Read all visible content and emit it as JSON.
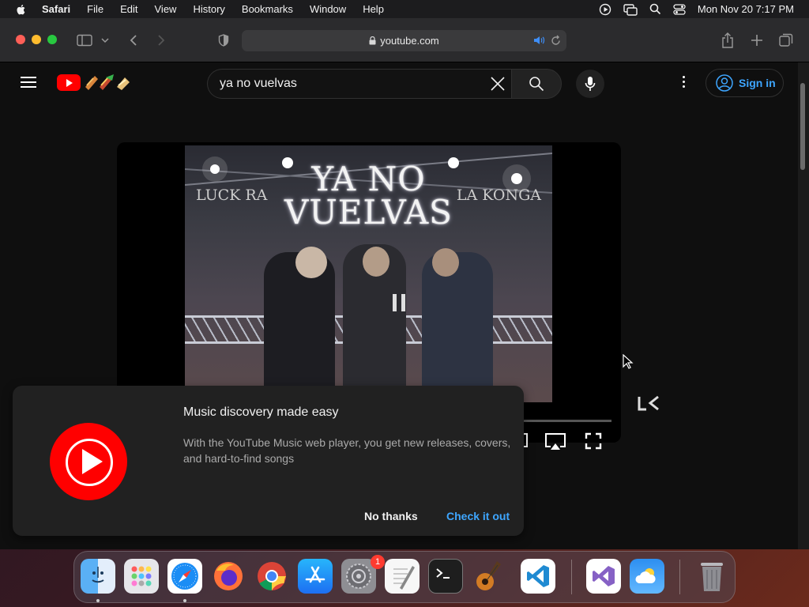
{
  "menubar": {
    "app_name": "Safari",
    "items": [
      "File",
      "Edit",
      "View",
      "History",
      "Bookmarks",
      "Window",
      "Help"
    ],
    "datetime": "Mon Nov 20  7:17 PM"
  },
  "browser": {
    "url": "youtube.com"
  },
  "youtube": {
    "search_query": "ya no vuelvas",
    "sign_in": "Sign in"
  },
  "video": {
    "title_line1": "YA NO",
    "title_line2": "VUELVAS",
    "artist_left": "LUCK RA",
    "artist_right": "LA KONGA"
  },
  "promo": {
    "title": "Music discovery made easy",
    "description": "With the YouTube Music web player, you get new releases, covers, and hard-to-find songs",
    "dismiss": "No thanks",
    "confirm": "Check it out"
  },
  "dock": {
    "apps": [
      "finder-icon",
      "launchpad-icon",
      "safari-icon",
      "firefox-icon",
      "chrome-icon",
      "app-store-icon",
      "system-settings-icon",
      "textedit-icon",
      "terminal-icon",
      "garageband-icon",
      "vscode-icon",
      "visual-studio-icon",
      "weather-icon",
      "trash-icon"
    ],
    "settings_badge": "1"
  },
  "colors": {
    "youtube_red": "#ff0000",
    "link_blue": "#3ea6ff"
  }
}
